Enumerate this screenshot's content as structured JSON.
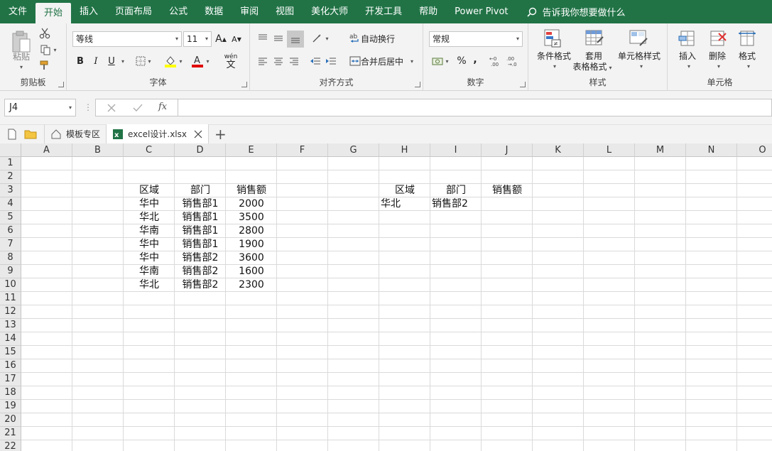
{
  "ribbon_tabs": [
    "文件",
    "开始",
    "插入",
    "页面布局",
    "公式",
    "数据",
    "审阅",
    "视图",
    "美化大师",
    "开发工具",
    "帮助",
    "Power Pivot"
  ],
  "active_tab": "开始",
  "tell_me": "告诉我你想要做什么",
  "clipboard": {
    "paste": "粘贴",
    "label": "剪贴板"
  },
  "font": {
    "name": "等线",
    "size": "11",
    "bold": "B",
    "italic": "I",
    "underline": "U",
    "grow": "A",
    "shrink": "A",
    "label": "字体",
    "wen": "wén",
    "wen_char": "文"
  },
  "alignment": {
    "wrap": "自动换行",
    "merge": "合并后居中",
    "label": "对齐方式"
  },
  "number": {
    "format": "常规",
    "percent": "%",
    "comma": ",",
    "label": "数字"
  },
  "styles": {
    "conditional": "条件格式",
    "table_line1": "套用",
    "table_line2": "表格格式",
    "cell_styles": "单元格样式",
    "label": "样式"
  },
  "cells": {
    "insert": "插入",
    "delete": "删除",
    "format": "格式",
    "label": "单元格"
  },
  "formula_bar": {
    "name_box": "J4",
    "fx": "fx",
    "value": ""
  },
  "doc_tabs": {
    "template": "模板专区",
    "file": "excel设计.xlsx"
  },
  "columns": [
    "A",
    "B",
    "C",
    "D",
    "E",
    "F",
    "G",
    "H",
    "I",
    "J",
    "K",
    "L",
    "M",
    "N",
    "O"
  ],
  "rows": [
    "1",
    "2",
    "3",
    "4",
    "5",
    "6",
    "7",
    "8",
    "9",
    "10",
    "11",
    "12",
    "13",
    "14",
    "15",
    "16",
    "17",
    "18",
    "19",
    "20",
    "21",
    "22"
  ],
  "table1": {
    "headers": [
      "区域",
      "部门",
      "销售额"
    ],
    "rows": [
      [
        "华中",
        "销售部1",
        "2000"
      ],
      [
        "华北",
        "销售部1",
        "3500"
      ],
      [
        "华南",
        "销售部1",
        "2800"
      ],
      [
        "华中",
        "销售部1",
        "1900"
      ],
      [
        "华中",
        "销售部2",
        "3600"
      ],
      [
        "华南",
        "销售部2",
        "1600"
      ],
      [
        "华北",
        "销售部2",
        "2300"
      ]
    ]
  },
  "table2": {
    "headers": [
      "区域",
      "部门",
      "销售额"
    ],
    "row": [
      "华北",
      "销售部2",
      ""
    ]
  },
  "colors": {
    "accent": "#217346",
    "grid": "#dadada"
  }
}
